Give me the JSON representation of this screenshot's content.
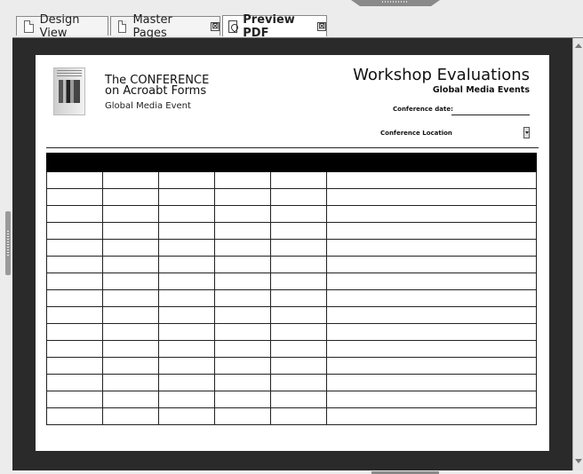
{
  "tabs": [
    {
      "label": "Design View",
      "active": false,
      "icon": "document-icon"
    },
    {
      "label": "Master Pages",
      "active": false,
      "icon": "document-icon",
      "closable": true
    },
    {
      "label": "Preview PDF",
      "active": true,
      "icon": "pdf-icon",
      "closable": true
    }
  ],
  "close_glyph": "⊠",
  "form": {
    "org_line1": "The CONFERENCE",
    "org_line2": "on Acroabt Forms",
    "org_line3": "Global Media Event",
    "title": "Workshop Evaluations",
    "subtitle": "Global Media Events",
    "date_label": "Conference date:",
    "location_label": "Conference Location"
  },
  "table": {
    "columns": 6,
    "rows": 15
  },
  "colors": {
    "viewer_bg": "#2a2a2a",
    "page_bg": "#ffffff",
    "header_fill": "#000000"
  }
}
